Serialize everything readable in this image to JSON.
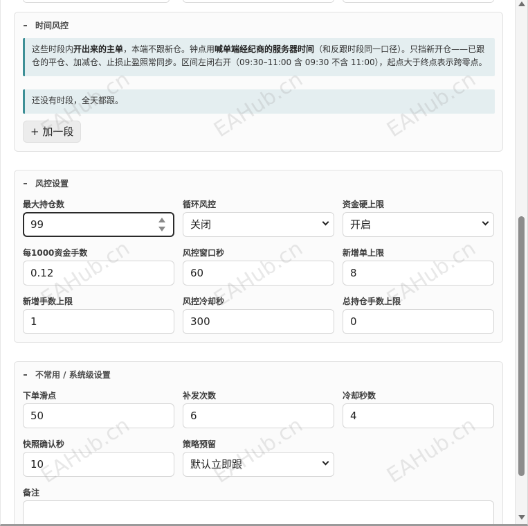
{
  "watermark_text": "EAHub.cn",
  "time_section": {
    "title": "时间风控",
    "note_parts": [
      "这些时段内",
      "开出来的主单",
      "，本端不跟新仓。钟点用",
      "喊单端经纪商的服务器时间",
      "（和反跟时段同一口径）。只挡新开仓——已跟仓的平仓、加减仓、止损止盈照常同步。区间左闭右开（09:30–11:00 含 09:30 不含 11:00），起点大于终点表示跨零点。"
    ],
    "empty_notice": "还没有时段，全天都跟。",
    "add_button": "+ 加一段"
  },
  "risk_section": {
    "title": "风控设置",
    "fields": [
      {
        "label": "最大持仓数",
        "value": "99"
      },
      {
        "label": "循环风控",
        "value": "关闭"
      },
      {
        "label": "资金硬上限",
        "value": "开启"
      },
      {
        "label": "每1000资金手数",
        "value": "0.12"
      },
      {
        "label": "风控窗口秒",
        "value": "60"
      },
      {
        "label": "新增单上限",
        "value": "8"
      },
      {
        "label": "新增手数上限",
        "value": "1"
      },
      {
        "label": "风控冷却秒",
        "value": "300"
      },
      {
        "label": "总持仓手数上限",
        "value": "0"
      }
    ]
  },
  "advanced_section": {
    "title": "不常用 / 系统级设置",
    "fields": [
      {
        "label": "下单滑点",
        "value": "50"
      },
      {
        "label": "补发次数",
        "value": "6"
      },
      {
        "label": "冷却秒数",
        "value": "4"
      },
      {
        "label": "快照确认秒",
        "value": "10"
      },
      {
        "label": "策略预留",
        "value": "默认立即跟"
      }
    ],
    "notes_label": "备注",
    "notes_value": ""
  }
}
